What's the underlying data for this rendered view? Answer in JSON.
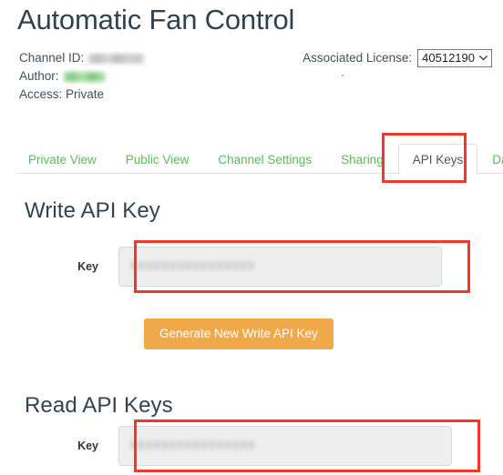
{
  "header": {
    "title": "Automatic Fan Control",
    "channel_id_label": "Channel ID:",
    "channel_id_value": "",
    "author_label": "Author:",
    "author_value": "",
    "access_line": "Access: Private",
    "license_label": "Associated License:",
    "license_value": "40512190",
    "chevron_icon": "chevron-down-icon"
  },
  "tabs": [
    {
      "label": "Private View",
      "active": false
    },
    {
      "label": "Public View",
      "active": false
    },
    {
      "label": "Channel Settings",
      "active": false
    },
    {
      "label": "Sharing",
      "active": false
    },
    {
      "label": "API Keys",
      "active": true
    },
    {
      "label": "Data",
      "active": false
    }
  ],
  "write_section": {
    "title": "Write API Key",
    "key_label": "Key",
    "key_value": "XXXXXXXXXXXXXXXX",
    "generate_button": "Generate New Write API Key"
  },
  "read_section": {
    "title": "Read API Keys",
    "key_label": "Key",
    "key_value": "XXXXXXXXXXXXXXXX"
  },
  "colors": {
    "tab_link": "#5cb85c",
    "tab_active_text": "#555555",
    "heading": "#33424f",
    "button_orange": "#efa94a",
    "annotation_red": "#f0372c",
    "input_bg": "#eeeeee"
  }
}
